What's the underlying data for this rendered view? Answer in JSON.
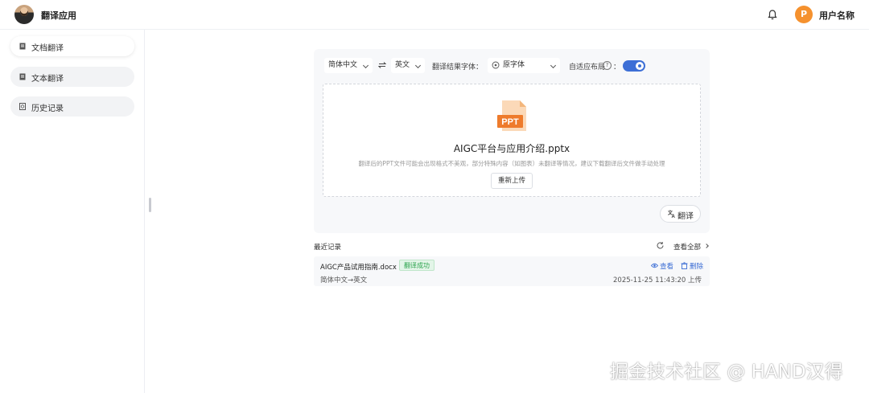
{
  "app": {
    "title": "翻译应用",
    "user_avatar_letter": "P",
    "user_name": "用户名称"
  },
  "sidebar": {
    "items": [
      {
        "label": "文档翻译",
        "icon": "document-icon",
        "active": true
      },
      {
        "label": "文本翻译",
        "icon": "text-doc-icon",
        "active": false
      },
      {
        "label": "历史记录",
        "icon": "history-icon",
        "active": false
      }
    ]
  },
  "toolbar": {
    "source_lang": "简体中文",
    "target_lang": "英文",
    "font_label": "翻译结果字体：",
    "font_value": "原字体",
    "adaptive_label": "自适应布局",
    "adaptive_suffix": "：",
    "adaptive_on": true
  },
  "upload": {
    "file_icon_text": "PPT",
    "file_name": "AIGC平台与应用介绍.pptx",
    "hint": "翻译后的PPT文件可能会出现格式不美观，部分特殊内容（如图表）未翻译等情况，建议下载翻译后文件做手动处理",
    "reupload_label": "重新上传"
  },
  "translate_button": {
    "label": "翻译"
  },
  "recent": {
    "title": "最近记录",
    "view_all": "查看全部",
    "records": [
      {
        "file": "AIGC产品试用指南.docx",
        "status": "翻译成功",
        "lang": "简体中文→英文",
        "time": "2025-11-25 11:43:20 上传",
        "view": "查看",
        "delete": "删除"
      }
    ]
  },
  "colors": {
    "accent": "#3d6fd6",
    "success": "#2da44e",
    "orange": "#f5912e"
  },
  "watermark": "掘金技术社区 @ HAND汉得"
}
